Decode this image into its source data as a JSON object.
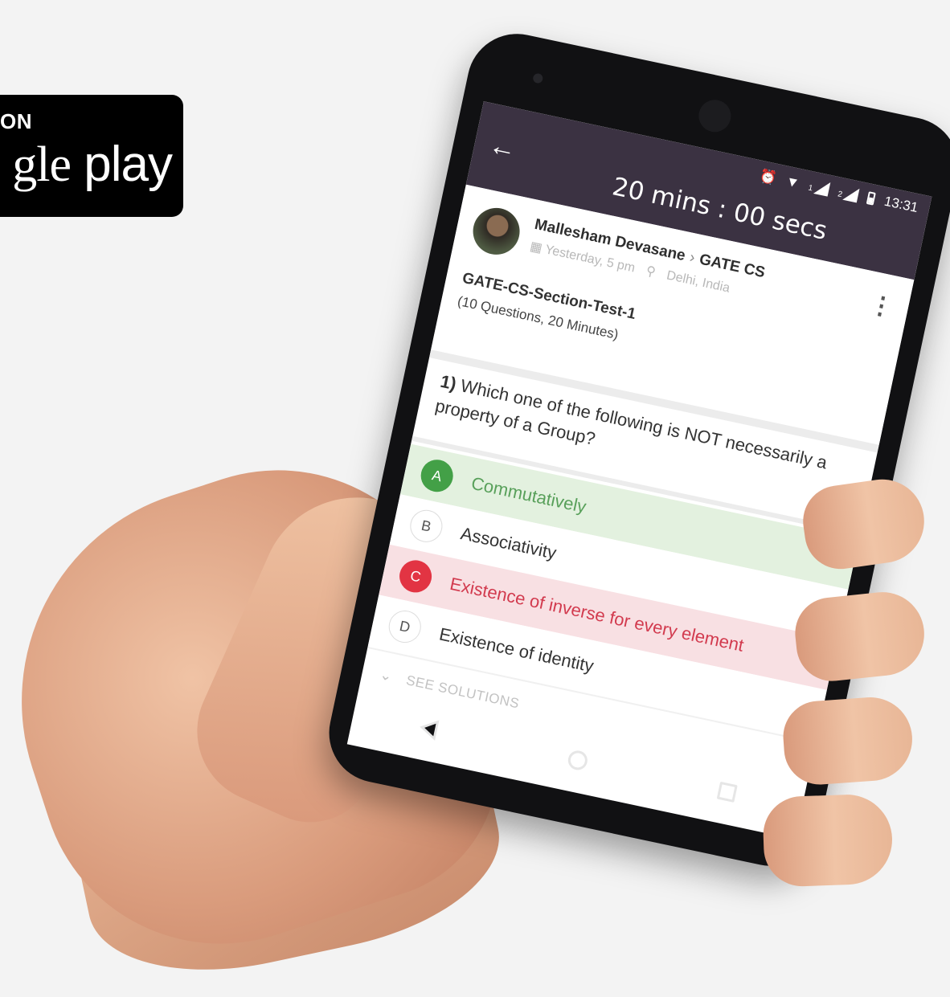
{
  "badge": {
    "top_text": "ON",
    "main_text_prefix": "gle",
    "main_text_suffix": " play"
  },
  "status_bar": {
    "time": "13:31",
    "sim1": "1",
    "sim2": "2",
    "icons": [
      "alarm-icon",
      "wifi-icon",
      "signal-icon",
      "signal-icon",
      "battery-icon"
    ]
  },
  "app_bar": {
    "timer": "20 mins : 00 secs",
    "back_icon": "back-arrow-icon",
    "accent": "#3b3242"
  },
  "post": {
    "author": "Mallesham Devasane",
    "channel": "GATE CS",
    "time": "Yesterday, 5 pm",
    "location": "Delhi, India",
    "test_title": "GATE-CS-Section-Test-1",
    "test_details": "(10 Questions, 20 Minutes)"
  },
  "question": {
    "number": "1)",
    "text": "Which one of the following is NOT necessarily a property of a Group?"
  },
  "options": [
    {
      "letter": "A",
      "text": "Commutatively",
      "state": "correct"
    },
    {
      "letter": "B",
      "text": "Associativity",
      "state": "neutral"
    },
    {
      "letter": "C",
      "text": "Existence of inverse for every element",
      "state": "wrong"
    },
    {
      "letter": "D",
      "text": "Existence of identity",
      "state": "neutral"
    }
  ],
  "see_solutions": "SEE SOLUTIONS",
  "colors": {
    "correct": "#43a047",
    "wrong": "#e23443"
  }
}
